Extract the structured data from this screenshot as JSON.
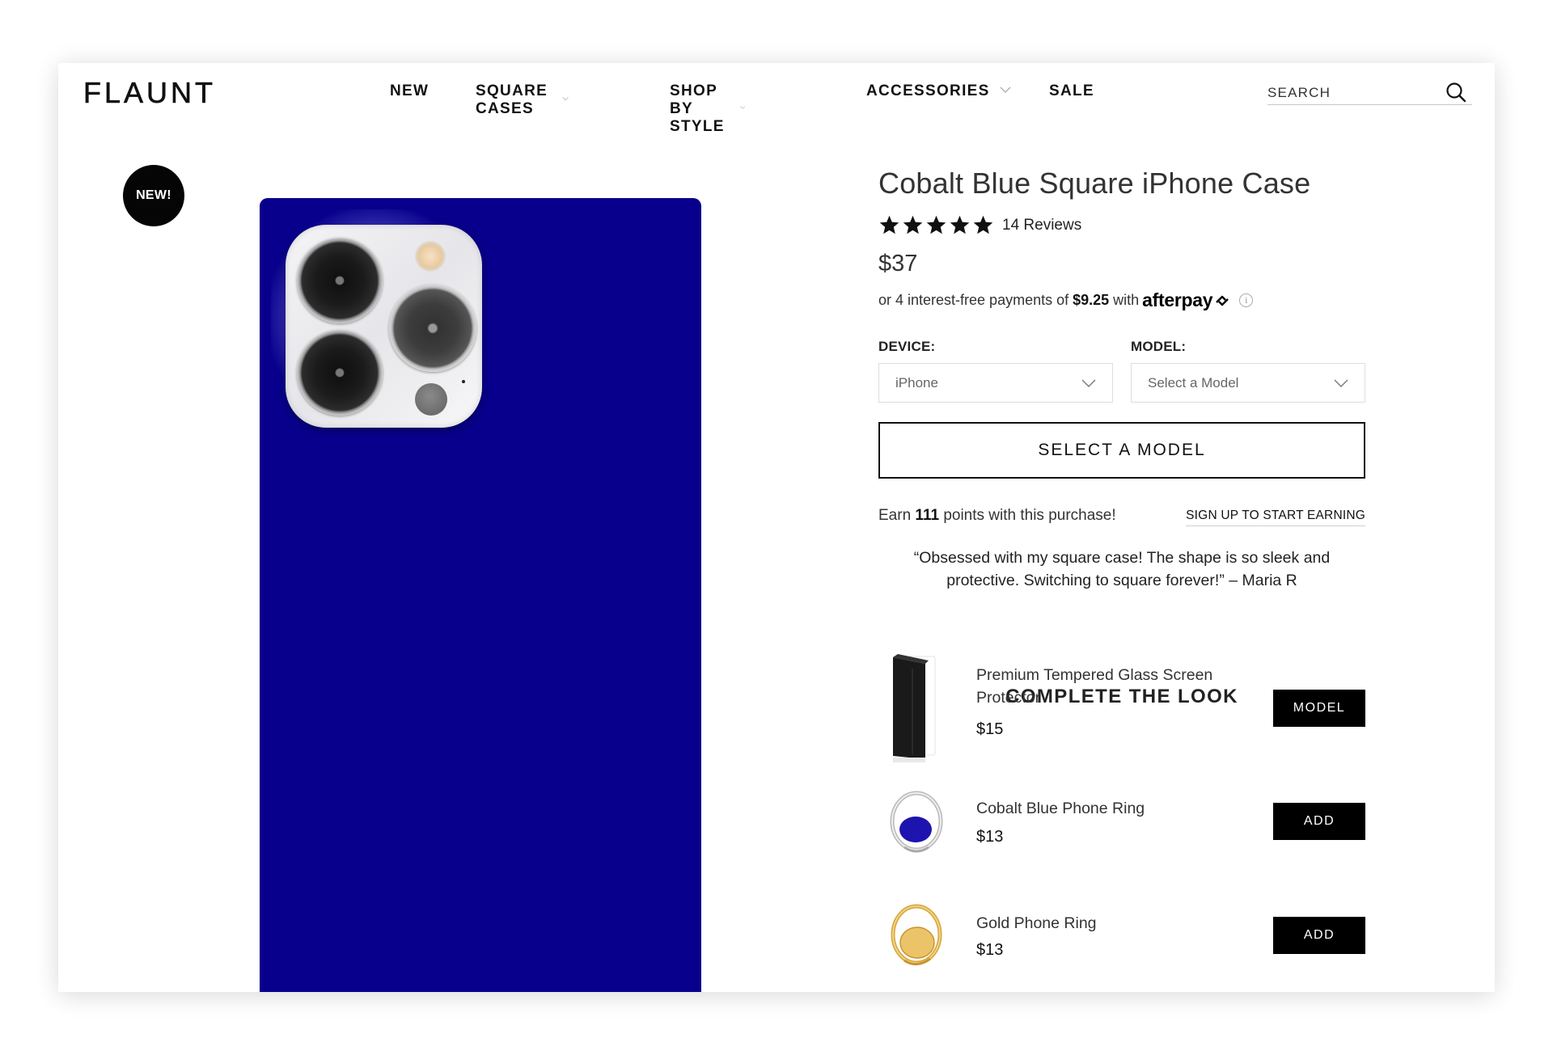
{
  "header": {
    "logo": "FLAUNT",
    "nav": [
      {
        "label": "NEW",
        "has_dropdown": false
      },
      {
        "label": "SQUARE CASES",
        "has_dropdown": true
      },
      {
        "label": "SHOP BY STYLE",
        "has_dropdown": true
      },
      {
        "label": "ACCESSORIES",
        "has_dropdown": true
      },
      {
        "label": "SALE",
        "has_dropdown": false
      }
    ],
    "search": {
      "placeholder": "SEARCH",
      "value": "",
      "icon": "search-icon"
    }
  },
  "gallery": {
    "badge": "NEW!",
    "case_color": "#08008c"
  },
  "product": {
    "title": "Cobalt Blue Square iPhone Case",
    "rating": 5,
    "rating_max": 5,
    "reviews_label": "14 Reviews",
    "price": "$37",
    "afterpay": {
      "prefix": "or 4 interest-free payments of",
      "amount": "$9.25",
      "with": "with",
      "brand": "afterpay",
      "info_icon": "i"
    },
    "device": {
      "label": "DEVICE:",
      "value": "iPhone"
    },
    "model": {
      "label": "MODEL:",
      "placeholder": "Select a Model"
    },
    "cta": "SELECT A MODEL",
    "points": {
      "prefix": "Earn",
      "amount": "111",
      "suffix": "points with this purchase!",
      "signup_link": "SIGN UP TO START EARNING"
    },
    "quote": "“Obsessed with my square case! The shape is so sleek and protective. Switching to square forever!” – Maria R"
  },
  "complete_the_look": {
    "title": "COMPLETE THE LOOK",
    "items": [
      {
        "name": "Premium Tempered Glass Screen Protector",
        "price": "$15",
        "button": "MODEL"
      },
      {
        "name": "Cobalt Blue Phone Ring",
        "price": "$13",
        "button": "ADD"
      },
      {
        "name": "Gold Phone Ring",
        "price": "$13",
        "button": "ADD"
      }
    ]
  }
}
